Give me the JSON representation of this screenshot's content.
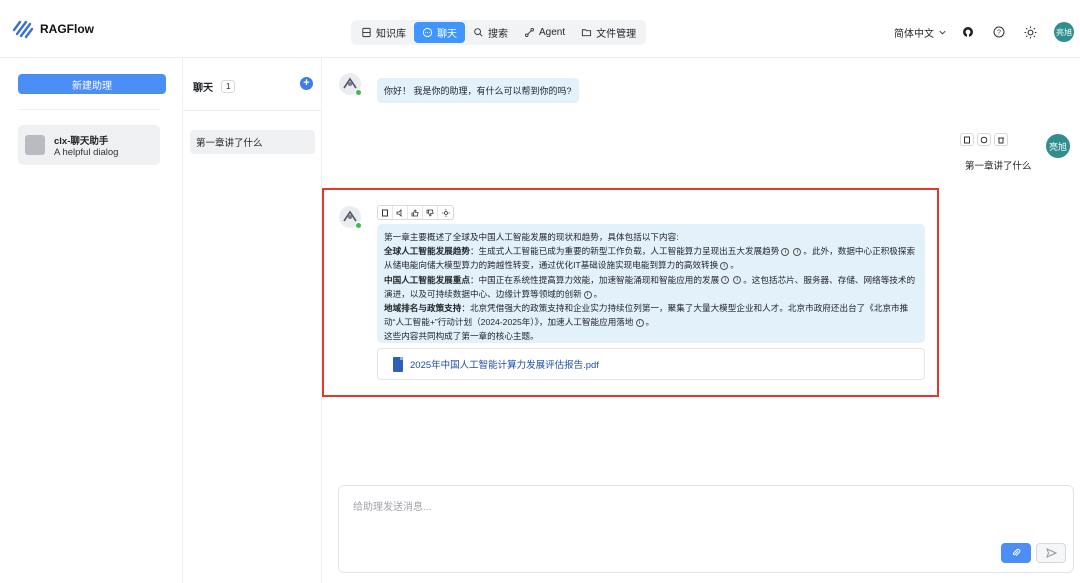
{
  "app": {
    "name": "RAGFlow"
  },
  "nav": {
    "items": [
      {
        "label": "知识库",
        "icon": "database-icon",
        "active": false
      },
      {
        "label": "聊天",
        "icon": "chat-icon",
        "active": true
      },
      {
        "label": "搜索",
        "icon": "search-icon",
        "active": false
      },
      {
        "label": "Agent",
        "icon": "agent-icon",
        "active": false
      },
      {
        "label": "文件管理",
        "icon": "folder-icon",
        "active": false
      }
    ]
  },
  "header": {
    "language": "简体中文",
    "user_avatar_text": "亮旭"
  },
  "sidebar": {
    "new_button": "新建助理",
    "assistant": {
      "name": "clx-聊天助手",
      "description": "A helpful dialog"
    }
  },
  "conversations": {
    "title": "聊天",
    "count": "1",
    "items": [
      {
        "label": "第一章讲了什么"
      }
    ]
  },
  "chat": {
    "greeting": "你好！ 我是你的助理，有什么可以帮到你的吗?",
    "user_message": "第一章讲了什么",
    "user_avatar_text": "亮旭",
    "answer": {
      "intro": "第一章主要概述了全球及中国人工智能发展的现状和趋势，具体包括以下内容:",
      "p1_title": "全球人工智能发展趋势",
      "p1_a": "：生成式人工智能已成为重要的新型工作负载，人工智能算力呈现出五大发展趋势",
      "p1_b": "。此外，数据中心正积极探索从储电能向储大模型算力的跨越性转变，通过优化IT基础设施实现电能到算力的高效转换",
      "p1_c": "。",
      "p2_title": "中国人工智能发展重点",
      "p2_a": "：中国正在系统性提高算力效能，加速智能涌现和智能应用的发展",
      "p2_b": "。这包括芯片、服务器、存储、网络等技术的演进，以及可持续数据中心、边缘计算等领域的创新",
      "p2_c": "。",
      "p3_title": "地域排名与政策支持",
      "p3_a": "：北京凭借强大的政策支持和企业实力持续位列第一，聚集了大量大模型企业和人才。北京市政府还出台了《北京市推动“人工智能+”行动计划（2024-2025年）》，加速人工智能应用落地",
      "p3_c": "。",
      "outro": "这些内容共同构成了第一章的核心主题。",
      "reference_mark": "i"
    },
    "file_name": "2025年中国人工智能计算力发展评估报告.pdf",
    "input_placeholder": "给助理发送消息..."
  },
  "colors": {
    "accent": "#4b8ef5",
    "highlight_border": "#e03a30",
    "bubble": "#e3f1fb"
  }
}
